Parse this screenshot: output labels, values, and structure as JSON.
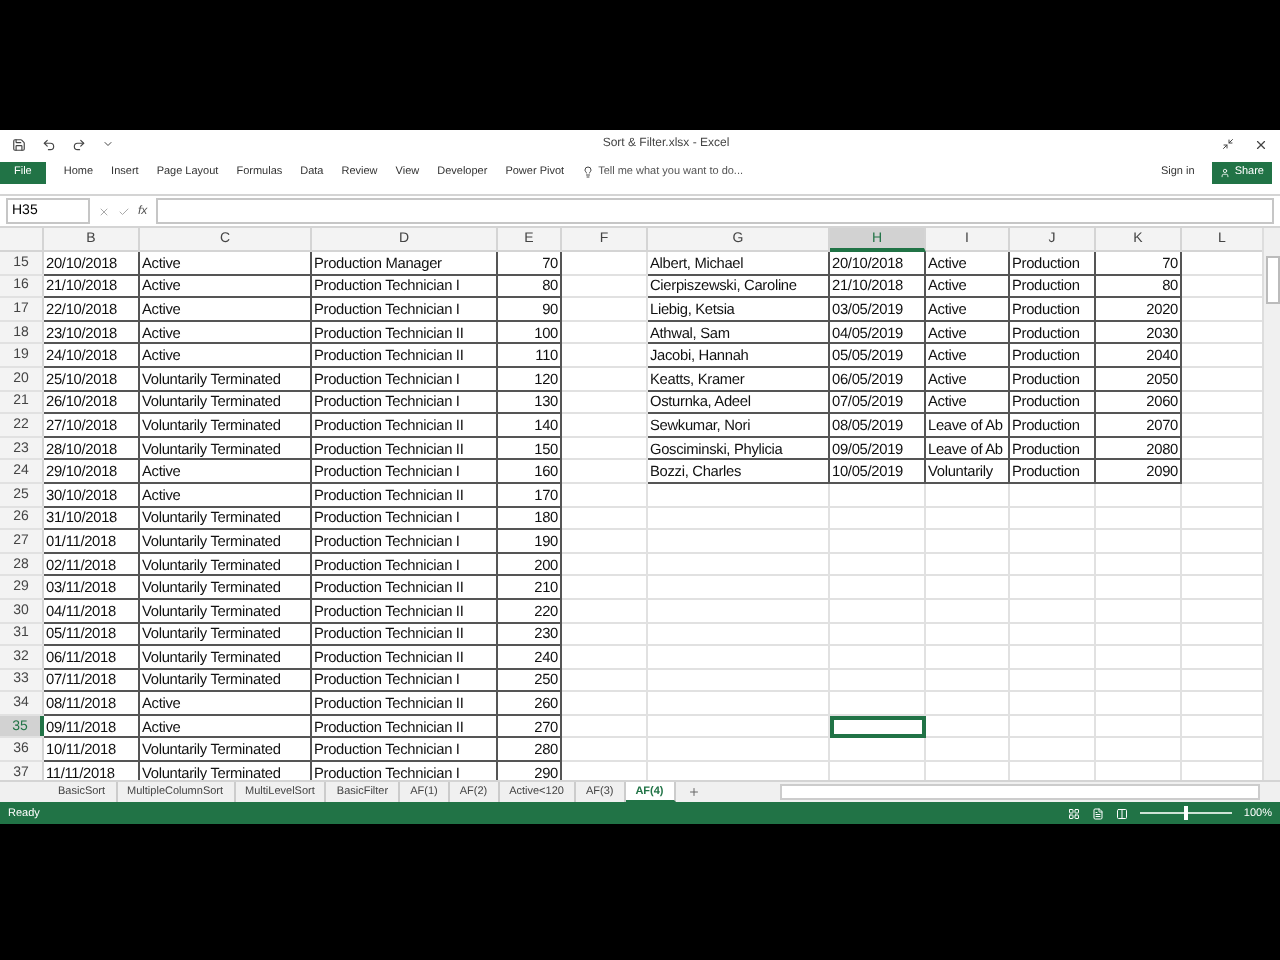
{
  "window": {
    "title": "Sort & Filter.xlsx - Excel"
  },
  "ribbon": {
    "tabs": [
      {
        "label": "File",
        "kind": "file",
        "selected": false
      },
      {
        "label": "Home",
        "kind": "tab",
        "selected": false
      },
      {
        "label": "Insert",
        "kind": "tab",
        "selected": false
      },
      {
        "label": "Page Layout",
        "kind": "tab",
        "selected": false
      },
      {
        "label": "Formulas",
        "kind": "tab",
        "selected": false
      },
      {
        "label": "Data",
        "kind": "tab",
        "selected": false
      },
      {
        "label": "Review",
        "kind": "tab",
        "selected": false
      },
      {
        "label": "View",
        "kind": "tab",
        "selected": false
      },
      {
        "label": "Developer",
        "kind": "tab",
        "selected": false
      },
      {
        "label": "Power Pivot",
        "kind": "tab",
        "selected": false
      }
    ],
    "tell_me": {
      "placeholder": "Tell me what you want to do..."
    },
    "sign_in": "Sign in",
    "share": "Share"
  },
  "formula_bar": {
    "name_box": "H35",
    "function_label": "fx"
  },
  "columns": [
    {
      "letter": "B",
      "selected": false
    },
    {
      "letter": "C",
      "selected": false
    },
    {
      "letter": "D",
      "selected": false
    },
    {
      "letter": "E",
      "selected": false
    },
    {
      "letter": "F",
      "selected": false
    },
    {
      "letter": "G",
      "selected": false
    },
    {
      "letter": "H",
      "selected": true
    },
    {
      "letter": "I",
      "selected": false
    },
    {
      "letter": "J",
      "selected": false
    },
    {
      "letter": "K",
      "selected": false
    },
    {
      "letter": "L",
      "selected": false
    }
  ],
  "rows": [
    {
      "number": "15",
      "selected": false,
      "left_cells": [
        "20/10/2018",
        "Active",
        "Production Manager",
        "70"
      ],
      "right_cells": [
        "Albert, Michael",
        "20/10/2018",
        "Active",
        "Production",
        "70"
      ]
    },
    {
      "number": "16",
      "selected": false,
      "left_cells": [
        "21/10/2018",
        "Active",
        "Production Technician I",
        "80"
      ],
      "right_cells": [
        "Cierpiszewski, Caroline",
        "21/10/2018",
        "Active",
        "Production",
        "80"
      ]
    },
    {
      "number": "17",
      "selected": false,
      "left_cells": [
        "22/10/2018",
        "Active",
        "Production Technician I",
        "90"
      ],
      "right_cells": [
        "Liebig, Ketsia",
        "03/05/2019",
        "Active",
        "Production",
        "2020"
      ]
    },
    {
      "number": "18",
      "selected": false,
      "left_cells": [
        "23/10/2018",
        "Active",
        "Production Technician II",
        "100"
      ],
      "right_cells": [
        "Athwal, Sam",
        "04/05/2019",
        "Active",
        "Production",
        "2030"
      ]
    },
    {
      "number": "19",
      "selected": false,
      "left_cells": [
        "24/10/2018",
        "Active",
        "Production Technician II",
        "110"
      ],
      "right_cells": [
        "Jacobi, Hannah",
        "05/05/2019",
        "Active",
        "Production",
        "2040"
      ]
    },
    {
      "number": "20",
      "selected": false,
      "left_cells": [
        "25/10/2018",
        "Voluntarily Terminated",
        "Production Technician I",
        "120"
      ],
      "right_cells": [
        "Keatts, Kramer",
        "06/05/2019",
        "Active",
        "Production",
        "2050"
      ]
    },
    {
      "number": "21",
      "selected": false,
      "left_cells": [
        "26/10/2018",
        "Voluntarily Terminated",
        "Production Technician I",
        "130"
      ],
      "right_cells": [
        "Osturnka, Adeel",
        "07/05/2019",
        "Active",
        "Production",
        "2060"
      ]
    },
    {
      "number": "22",
      "selected": false,
      "left_cells": [
        "27/10/2018",
        "Voluntarily Terminated",
        "Production Technician II",
        "140"
      ],
      "right_cells": [
        "Sewkumar, Nori",
        "08/05/2019",
        "Leave of Ab",
        "Production",
        "2070"
      ]
    },
    {
      "number": "23",
      "selected": false,
      "left_cells": [
        "28/10/2018",
        "Voluntarily Terminated",
        "Production Technician II",
        "150"
      ],
      "right_cells": [
        "Gosciminski, Phylicia",
        "09/05/2019",
        "Leave of Ab",
        "Production",
        "2080"
      ]
    },
    {
      "number": "24",
      "selected": false,
      "left_cells": [
        "29/10/2018",
        "Active",
        "Production Technician I",
        "160"
      ],
      "right_cells": [
        "Bozzi, Charles",
        "10/05/2019",
        "Voluntarily",
        "Production",
        "2090"
      ]
    },
    {
      "number": "25",
      "selected": false,
      "left_cells": [
        "30/10/2018",
        "Active",
        "Production Technician II",
        "170"
      ]
    },
    {
      "number": "26",
      "selected": false,
      "left_cells": [
        "31/10/2018",
        "Voluntarily Terminated",
        "Production Technician I",
        "180"
      ]
    },
    {
      "number": "27",
      "selected": false,
      "left_cells": [
        "01/11/2018",
        "Voluntarily Terminated",
        "Production Technician I",
        "190"
      ]
    },
    {
      "number": "28",
      "selected": false,
      "left_cells": [
        "02/11/2018",
        "Voluntarily Terminated",
        "Production Technician I",
        "200"
      ]
    },
    {
      "number": "29",
      "selected": false,
      "left_cells": [
        "03/11/2018",
        "Voluntarily Terminated",
        "Production Technician II",
        "210"
      ]
    },
    {
      "number": "30",
      "selected": false,
      "left_cells": [
        "04/11/2018",
        "Voluntarily Terminated",
        "Production Technician II",
        "220"
      ]
    },
    {
      "number": "31",
      "selected": false,
      "left_cells": [
        "05/11/2018",
        "Voluntarily Terminated",
        "Production Technician II",
        "230"
      ]
    },
    {
      "number": "32",
      "selected": false,
      "left_cells": [
        "06/11/2018",
        "Voluntarily Terminated",
        "Production Technician II",
        "240"
      ]
    },
    {
      "number": "33",
      "selected": false,
      "left_cells": [
        "07/11/2018",
        "Voluntarily Terminated",
        "Production Technician I",
        "250"
      ]
    },
    {
      "number": "34",
      "selected": false,
      "left_cells": [
        "08/11/2018",
        "Active",
        "Production Technician II",
        "260"
      ]
    },
    {
      "number": "35",
      "selected": true,
      "left_cells": [
        "09/11/2018",
        "Active",
        "Production Technician II",
        "270"
      ]
    },
    {
      "number": "36",
      "selected": false,
      "left_cells": [
        "10/11/2018",
        "Voluntarily Terminated",
        "Production Technician I",
        "280"
      ]
    },
    {
      "number": "37",
      "selected": false,
      "left_cells": [
        "11/11/2018",
        "Voluntarily Terminated",
        "Production Technician I",
        "290"
      ]
    }
  ],
  "sheet_tabs": [
    {
      "label": "BasicSort",
      "selected": false
    },
    {
      "label": "MultipleColumnSort",
      "selected": false
    },
    {
      "label": "MultiLevelSort",
      "selected": false
    },
    {
      "label": "BasicFilter",
      "selected": false
    },
    {
      "label": "AF(1)",
      "selected": false
    },
    {
      "label": "AF(2)",
      "selected": false
    },
    {
      "label": "Active<120",
      "selected": false
    },
    {
      "label": "AF(3)",
      "selected": false
    },
    {
      "label": "AF(4)",
      "selected": true
    }
  ],
  "status_bar": {
    "status": "Ready",
    "zoom": "100%",
    "zoom_level": {
      "level": 0.5
    }
  }
}
